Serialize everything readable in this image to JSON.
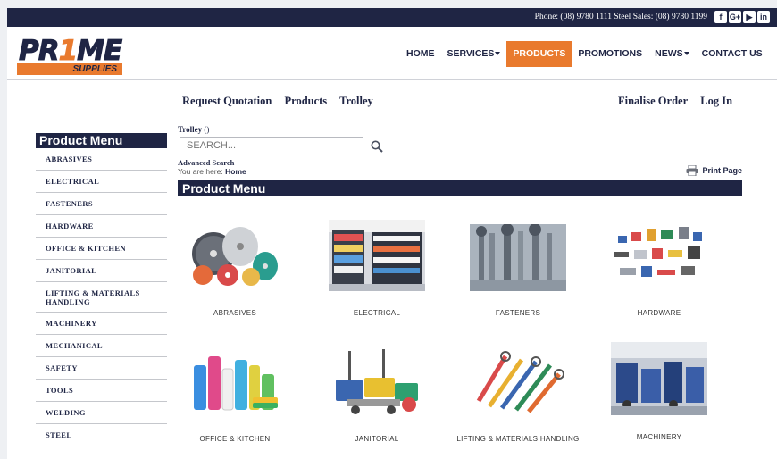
{
  "topbar": {
    "contact": "Phone: (08) 9780 1111  Steel Sales: (08) 9780 1199",
    "social": [
      {
        "icon": "facebook-icon",
        "glyph": "f"
      },
      {
        "icon": "googleplus-icon",
        "glyph": "G+"
      },
      {
        "icon": "youtube-icon",
        "glyph": "▶"
      },
      {
        "icon": "linkedin-icon",
        "glyph": "in"
      }
    ]
  },
  "logo": {
    "word_pre": "PR",
    "word_one": "1",
    "word_post": "ME",
    "sub": "SUPPLIES"
  },
  "nav": [
    {
      "label": "HOME",
      "dropdown": false,
      "active": false
    },
    {
      "label": "SERVICES",
      "dropdown": true,
      "active": false
    },
    {
      "label": "PRODUCTS",
      "dropdown": false,
      "active": true
    },
    {
      "label": "PROMOTIONS",
      "dropdown": false,
      "active": false
    },
    {
      "label": "NEWS",
      "dropdown": true,
      "active": false
    },
    {
      "label": "CONTACT US",
      "dropdown": false,
      "active": false
    }
  ],
  "subnav": {
    "left": [
      "Request Quotation",
      "Products",
      "Trolley"
    ],
    "right": [
      "Finalise Order",
      "Log In"
    ]
  },
  "sidebar": {
    "title": "Product Menu",
    "items": [
      "ABRASIVES",
      "ELECTRICAL",
      "FASTENERS",
      "HARDWARE",
      "OFFICE & KITCHEN",
      "JANITORIAL",
      "LIFTING & MATERIALS HANDLING",
      "MACHINERY",
      "MECHANICAL",
      "SAFETY",
      "TOOLS",
      "WELDING",
      "STEEL"
    ]
  },
  "main": {
    "trolley_label": "Trolley",
    "trolley_count": "()",
    "search_placeholder": "SEARCH...",
    "advanced_search": "Advanced Search",
    "breadcrumb_prefix": "You are here:",
    "breadcrumb_current": "Home",
    "print_label": "Print Page",
    "section_title": "Product Menu"
  },
  "products": [
    "ABRASIVES",
    "ELECTRICAL",
    "FASTENERS",
    "HARDWARE",
    "OFFICE & KITCHEN",
    "JANITORIAL",
    "LIFTING & MATERIALS HANDLING",
    "MACHINERY"
  ],
  "colors": {
    "navy": "#1f2544",
    "orange": "#e97a2e",
    "white": "#ffffff"
  }
}
